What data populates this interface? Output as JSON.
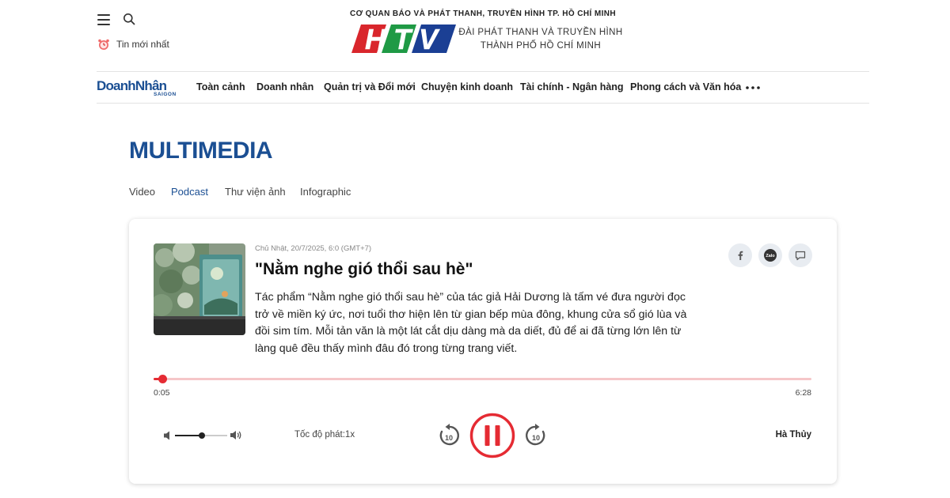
{
  "header": {
    "latest_news": "Tin mới nhất",
    "agency_line": "CƠ QUAN BÁO VÀ PHÁT THANH, TRUYỀN HÌNH TP. HỒ CHÍ MINH",
    "logo_text": "HTV",
    "station_line1": "ĐÀI PHÁT THANH VÀ TRUYỀN HÌNH",
    "station_line2": "THÀNH PHỐ HỒ CHÍ MINH"
  },
  "brand": {
    "name": "DoanhNhân",
    "sub": "SAIGON",
    "color": "#1b4f93"
  },
  "nav": {
    "items": [
      {
        "label": "Toàn cảnh"
      },
      {
        "label": "Doanh nhân"
      },
      {
        "label": "Quản trị và Đổi mới"
      },
      {
        "label": "Chuyện kinh doanh"
      },
      {
        "label": "Tài chính - Ngân hàng"
      },
      {
        "label": "Phong cách và Văn hóa"
      }
    ],
    "more_icon": "more-dots-icon"
  },
  "section": {
    "title": "MULTIMEDIA",
    "tabs": [
      {
        "label": "Video",
        "active": false
      },
      {
        "label": "Podcast",
        "active": true
      },
      {
        "label": "Thư viện ảnh",
        "active": false
      },
      {
        "label": "Infographic",
        "active": false
      }
    ]
  },
  "podcast": {
    "date": "Chủ Nhật, 20/7/2025, 6:0 (GMT+7)",
    "title": "\"Nằm nghe gió thổi sau hè\"",
    "description": "Tác phẩm “Nằm nghe gió thổi sau hè” của tác giả Hải Dương là tấm vé đưa người đọc trở về miền ký ức, nơi tuổi thơ hiện lên từ gian bếp mùa đông, khung cửa sổ gió lùa và đồi sim tím. Mỗi tản văn là một lát cắt dịu dàng mà da diết, đủ để ai đã từng lớn lên từ làng quê đều thấy mình đâu đó trong từng trang viết.",
    "share": {
      "facebook_icon": "facebook-icon",
      "zalo_label": "Zalo",
      "comment_icon": "comment-icon"
    }
  },
  "player": {
    "current_time": "0:05",
    "duration": "6:28",
    "progress_fraction": 0.0129,
    "volume_fraction": 0.52,
    "speed_label": "Tốc độ phát:1x",
    "skip_back_label": "10",
    "skip_forward_label": "10",
    "state": "playing",
    "author": "Hà Thủy",
    "accent_color": "#e52b33"
  }
}
